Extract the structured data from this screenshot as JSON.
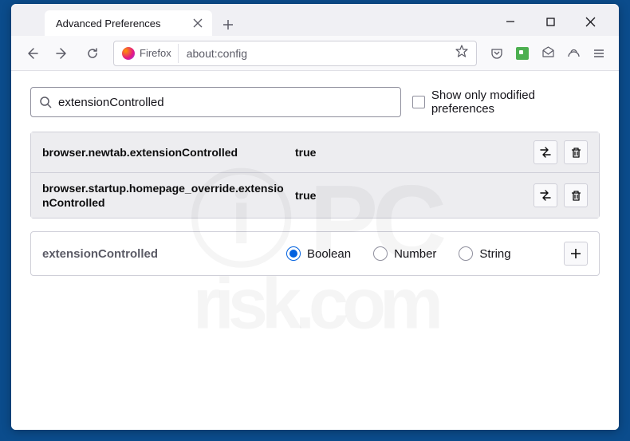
{
  "window": {
    "tab_title": "Advanced Preferences"
  },
  "urlbar": {
    "identity": "Firefox",
    "url": "about:config"
  },
  "config": {
    "search_value": "extensionControlled",
    "show_modified_label": "Show only modified preferences",
    "prefs": [
      {
        "name": "browser.newtab.extensionControlled",
        "value": "true"
      },
      {
        "name": "browser.startup.homepage_override.extensionControlled",
        "value": "true"
      }
    ],
    "new_pref": {
      "name": "extensionControlled",
      "types": {
        "boolean": "Boolean",
        "number": "Number",
        "string": "String"
      },
      "selected": "boolean"
    }
  }
}
